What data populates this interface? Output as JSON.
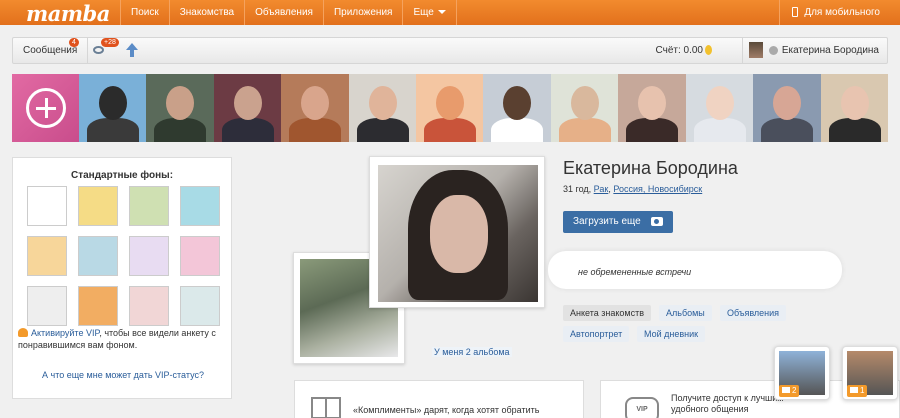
{
  "topnav": {
    "logo": "mamba",
    "items": [
      "Поиск",
      "Знакомства",
      "Объявления",
      "Приложения",
      "Еще"
    ],
    "mobile": "Для мобильного"
  },
  "bar": {
    "messages_label": "Сообщения",
    "messages_count": "4",
    "views_count": "+28",
    "account_label": "Счёт: 0.00",
    "user_name": "Екатерина Бородина"
  },
  "strip": {
    "add_label": "+",
    "faces": [
      {
        "bg": "#7ab0d8",
        "head": "#2b2b2b",
        "body": "#3a3a3a"
      },
      {
        "bg": "#5a6a5a",
        "head": "#c9a089",
        "body": "#2f3a2f"
      },
      {
        "bg": "#6c3b44",
        "head": "#caa28e",
        "body": "#2d2d3a"
      },
      {
        "bg": "#b57b5a",
        "head": "#d9a58c",
        "body": "#a0562f"
      },
      {
        "bg": "#d8d4cd",
        "head": "#e0b49a",
        "body": "#2c2c30"
      },
      {
        "bg": "#f4c6a2",
        "head": "#e89b6c",
        "body": "#c9543a"
      },
      {
        "bg": "#c6cdd6",
        "head": "#5a4030",
        "body": "#ffffff"
      },
      {
        "bg": "#dfe3d8",
        "head": "#d9b89d",
        "body": "#e6b088"
      },
      {
        "bg": "#c6a89a",
        "head": "#e7c2ae",
        "body": "#3a2a28"
      },
      {
        "bg": "#d6dbe0",
        "head": "#f0d3c2",
        "body": "#e6e9ee"
      },
      {
        "bg": "#8a9ab0",
        "head": "#d7a695",
        "body": "#4a4f5c"
      },
      {
        "bg": "#d9c8b0",
        "head": "#e8c4b0",
        "body": "#2a2a2a"
      }
    ]
  },
  "backgrounds": {
    "title": "Стандартные фоны:",
    "swatches": [
      "#ffffff",
      "#f5dc86",
      "#cfe0b2",
      "#a8dbe6",
      "#f7d69a",
      "#b9d9e5",
      "#e8dcf2",
      "#f3c6d8",
      "#eeeeee",
      "#f2ad62",
      "#f1d6d6",
      "#dbe9ea"
    ],
    "vip_link": "Активируйте VIP",
    "vip_desc": ", чтобы все видели анкету с понравившимся вам фоном.",
    "vip_more": "А что еще мне может дать VIP-статус?"
  },
  "profile": {
    "name": "Екатерина Бородина",
    "age": "31 год,",
    "sign": "Рак",
    "location": "Россия, Новосибирск",
    "upload_btn": "Загрузить еще",
    "status_text": "не обремененные встречи",
    "albums_link": "У меня 2 альбома",
    "tabs": [
      "Анкета знакомств",
      "Альбомы",
      "Объявления",
      "Автопортрет",
      "Мой дневник"
    ]
  },
  "cards": {
    "compliment_text": "«Комплименты» дарят, когда хотят обратить",
    "vip_label": "VIP",
    "access_text_1": "Получите доступ к лучшим",
    "access_text_2": "удобного общения"
  },
  "floating": [
    {
      "count": "2",
      "color": "#8fb2d8"
    },
    {
      "count": "1",
      "color": "#b58a6a"
    }
  ]
}
